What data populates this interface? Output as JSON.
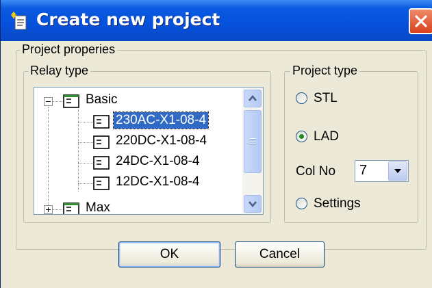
{
  "window": {
    "title": "Create new project"
  },
  "project_properties": {
    "label": "Project properies"
  },
  "relay_type": {
    "label": "Relay type",
    "tree": [
      {
        "label": "Basic",
        "level": 0,
        "expanded": true
      },
      {
        "label": "230AC-X1-08-4",
        "level": 1,
        "selected": true
      },
      {
        "label": "220DC-X1-08-4",
        "level": 1
      },
      {
        "label": "24DC-X1-08-4",
        "level": 1
      },
      {
        "label": "12DC-X1-08-4",
        "level": 1
      },
      {
        "label": "Max",
        "level": 0,
        "expanded": false
      }
    ]
  },
  "project_type": {
    "label": "Project type",
    "options": [
      {
        "label": "STL",
        "checked": false
      },
      {
        "label": "LAD",
        "checked": true
      },
      {
        "label": "Settings",
        "checked": false
      }
    ],
    "col_no_label": "Col No",
    "col_no_value": "7"
  },
  "buttons": {
    "ok": "OK",
    "cancel": "Cancel"
  },
  "colors": {
    "titlebar": "#0a5ae0",
    "selection": "#316ac5",
    "face": "#ece9d8",
    "close": "#d9401c"
  },
  "icons": {
    "app": "document-new-icon",
    "close": "close-icon",
    "tree_node": "relay-module-icon"
  }
}
